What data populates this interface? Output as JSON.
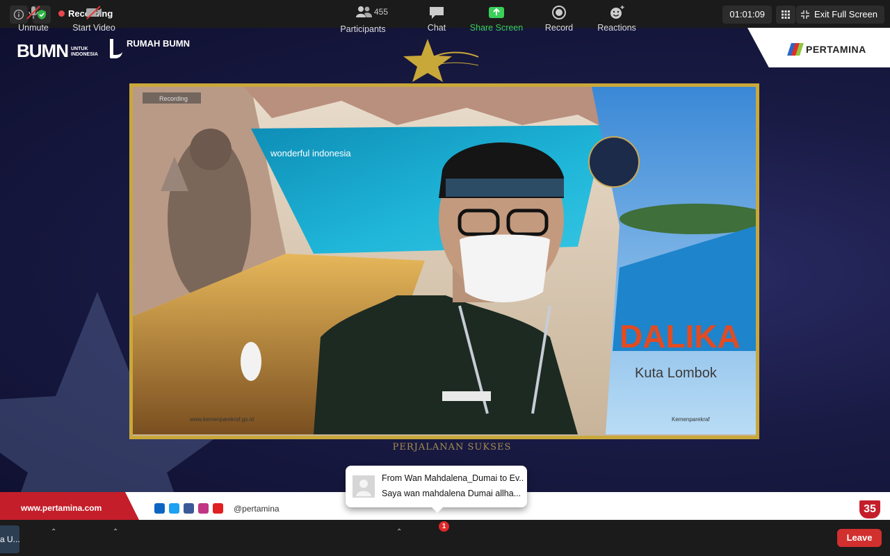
{
  "topbar": {
    "recording_label": "Recording",
    "timer": "01:01:09",
    "exit_fullscreen_label": "Exit Full Screen"
  },
  "stage": {
    "bumn_logo": "BUMN",
    "bumn_sub": "UNTUK INDONESIA",
    "rumah_bumn": "RUMAH BUMN",
    "pertamina_logo": "PERTAMINA",
    "website": "www.pertamina.com",
    "social_handle": "@pertamina",
    "subtitle": "PERJALANAN SUKSES",
    "badge": "35"
  },
  "video": {
    "overlay_recording": "Recording",
    "wonderful_indonesia": "wonderful indonesia",
    "mandalika": "DALIKA",
    "kuta_lombok": "Kuta Lombok",
    "website_small": "www.kemenparekraf.go.id",
    "handle_small": "Kemenparekraf"
  },
  "chat_toast": {
    "line1": "From Wan Mahdalena_Dumai to Ev...",
    "line2": "Saya wan mahdalena Dumai allha..."
  },
  "toolbar": {
    "name_pill": "a U...",
    "unmute": "Unmute",
    "start_video": "Start Video",
    "participants": "Participants",
    "participants_count": "455",
    "chat": "Chat",
    "chat_badge": "1",
    "share_screen": "Share Screen",
    "record": "Record",
    "reactions": "Reactions",
    "leave": "Leave"
  },
  "colors": {
    "accent_green": "#3ad05a",
    "leave_red": "#d22f2f",
    "frame_gold": "#c9a83a"
  }
}
